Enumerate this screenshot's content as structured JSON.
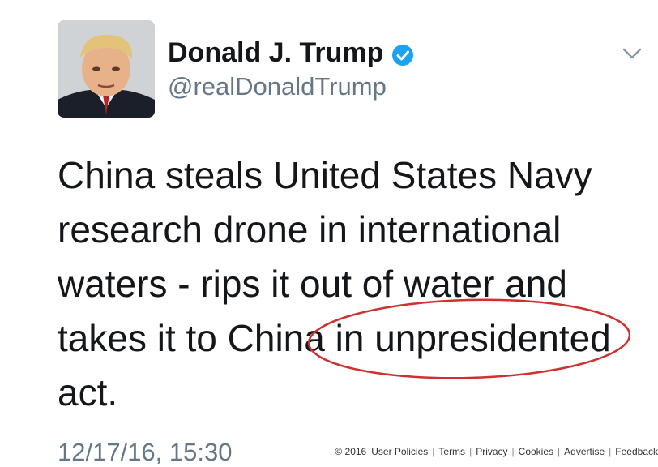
{
  "profile": {
    "name": "Donald J. Trump",
    "handle": "@realDonaldTrump",
    "avatar_icon": "profile-photo",
    "verified_icon": "verified-badge-icon",
    "verified_color": "#1da1f2"
  },
  "menu_icon": "chevron-down-icon",
  "tweet": {
    "lines": [
      "China steals United States Navy",
      "research drone in international",
      "waters - rips it out of water and",
      "takes it to China in unpresidented",
      "act."
    ],
    "timestamp": "12/17/16, 15:30"
  },
  "annotation": {
    "type": "red-ellipse",
    "color": "#d0302f"
  },
  "footer": {
    "copyright": "© 2016",
    "links": [
      "User Policies",
      "Terms",
      "Privacy",
      "Cookies",
      "Advertise",
      "Feedback"
    ]
  }
}
